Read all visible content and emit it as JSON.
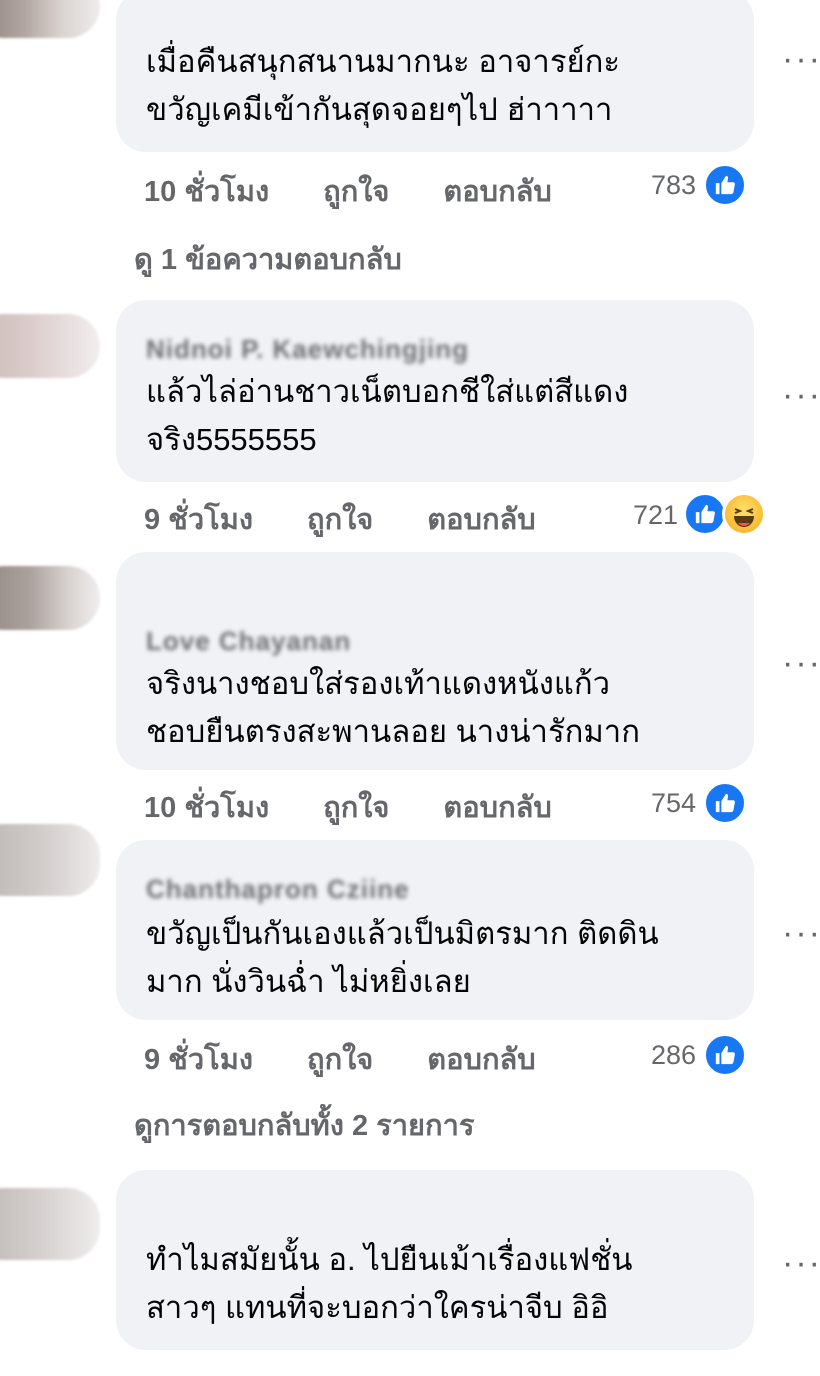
{
  "comments": [
    {
      "author": "",
      "text": "เมื่อคืนสนุกสนานมากนะ อาจารย์กะ\nขวัญเคมีเข้ากันสุดจอยๆไป ฮ่าาาาา",
      "time": "10 ชั่วโมง",
      "like_label": "ถูกใจ",
      "reply_label": "ตอบกลับ",
      "reaction_count": "783",
      "reactions": [
        "like-icon"
      ],
      "view_replies": "ดู 1 ข้อความตอบกลับ"
    },
    {
      "author": "Nidnoi P. Kaewchingjing",
      "text": "แล้วไล่อ่านชาวเน็ตบอกชีใส่แต่สีแดง\nจริง5555555",
      "time": "9 ชั่วโมง",
      "like_label": "ถูกใจ",
      "reply_label": "ตอบกลับ",
      "reaction_count": "721",
      "reactions": [
        "like-icon",
        "haha-icon"
      ]
    },
    {
      "author": "Love Chayanan",
      "text": "จริงนางชอบใส่รองเท้าแดงหนังแก้ว\nชอบยืนตรงสะพานลอย นางน่ารักมาก",
      "time": "10 ชั่วโมง",
      "like_label": "ถูกใจ",
      "reply_label": "ตอบกลับ",
      "reaction_count": "754",
      "reactions": [
        "like-icon"
      ]
    },
    {
      "author": "Chanthapron Cziine",
      "text": "ขวัญเป็นกันเองแล้วเป็นมิตรมาก ติดดิน\nมาก นั่งวินฉ่ำ ไม่หยิ่งเลย",
      "time": "9 ชั่วโมง",
      "like_label": "ถูกใจ",
      "reply_label": "ตอบกลับ",
      "reaction_count": "286",
      "reactions": [
        "like-icon"
      ],
      "view_replies": "ดูการตอบกลับทั้ง 2 รายการ"
    },
    {
      "author": "",
      "text": "ทำไมสมัยนั้น อ. ไปยืนเม้าเรื่องแฟชั่น\nสาวๆ แทนที่จะบอกว่าใครน่าจีบ อิอิ"
    }
  ],
  "more_icon": "more-options-icon",
  "more_glyph": "···",
  "colors": {
    "bubble": "#f0f2f5",
    "like": "#1877f2",
    "meta": "#65676b"
  }
}
